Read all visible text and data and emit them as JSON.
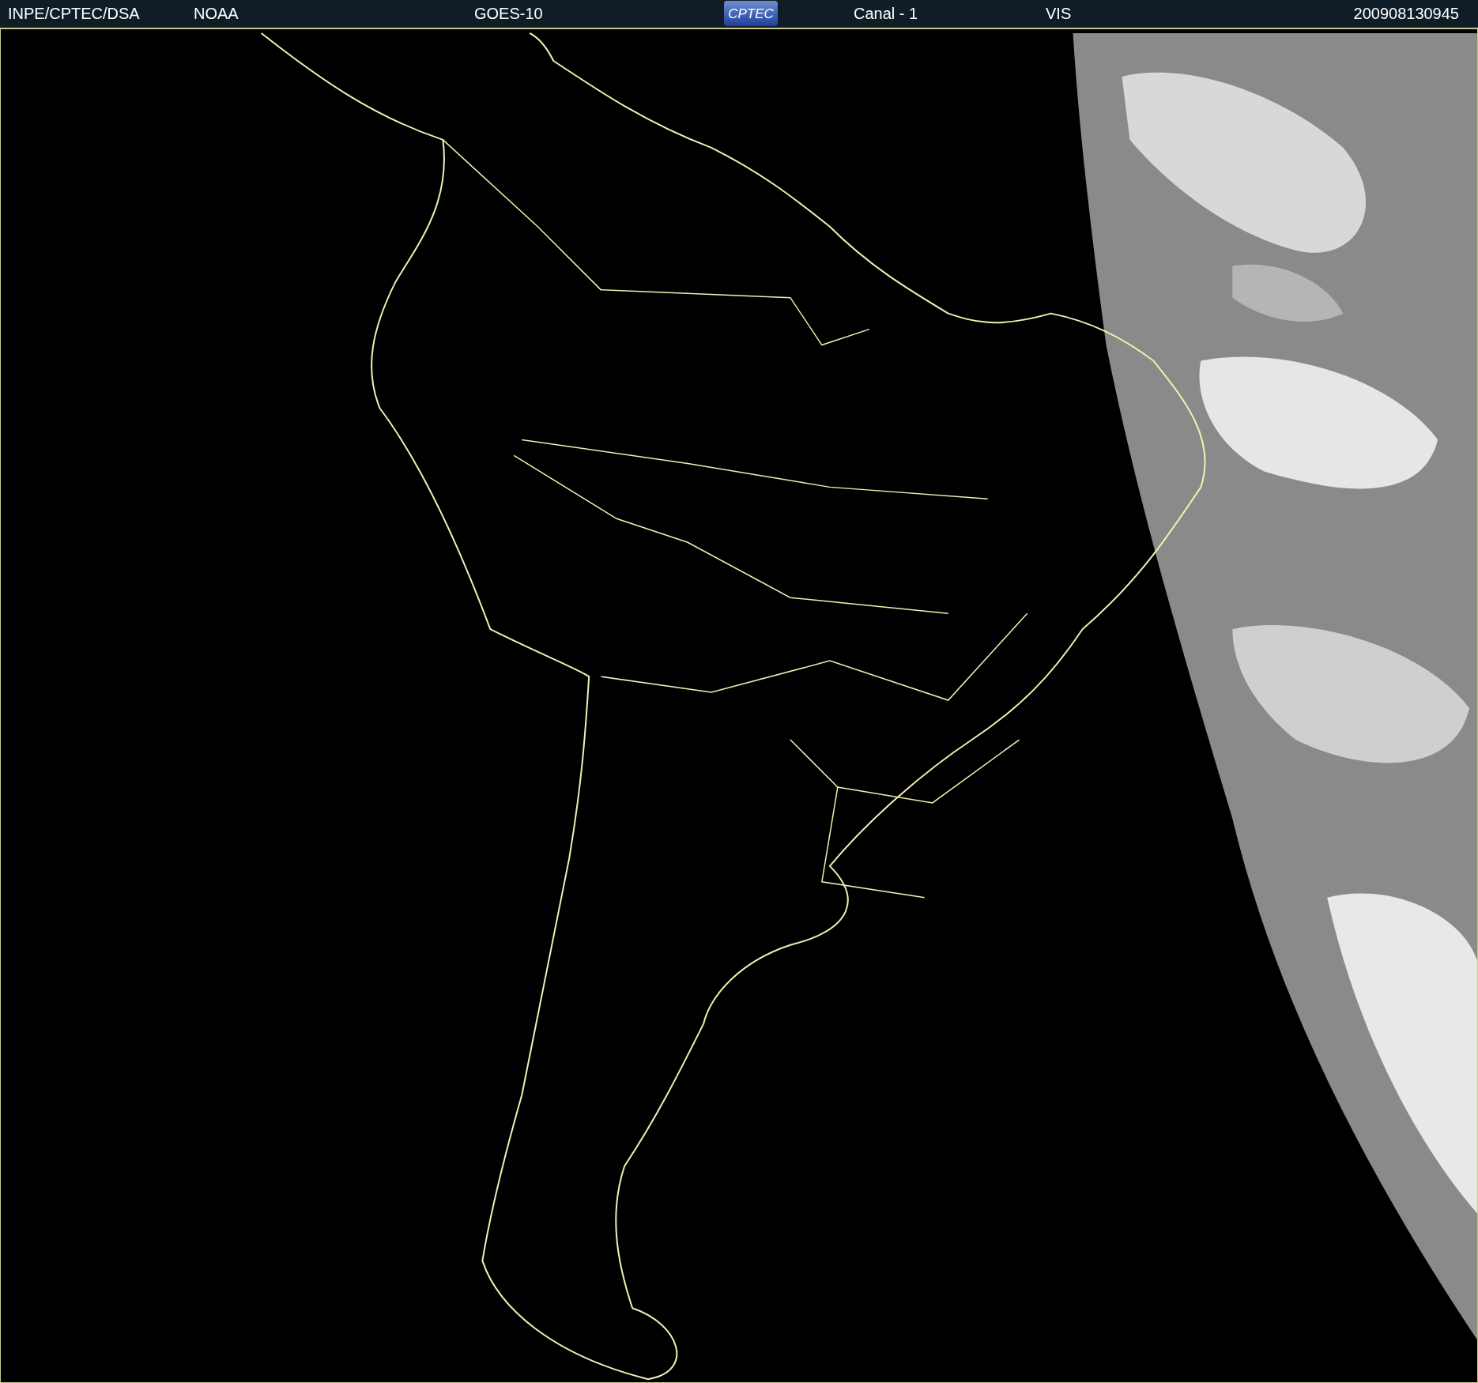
{
  "header": {
    "agency": "INPE/CPTEC/DSA",
    "source": "NOAA",
    "satellite": "GOES-10",
    "logo": "CPTEC",
    "channel": "Canal - 1",
    "band": "VIS",
    "timestamp": "200908130945"
  }
}
